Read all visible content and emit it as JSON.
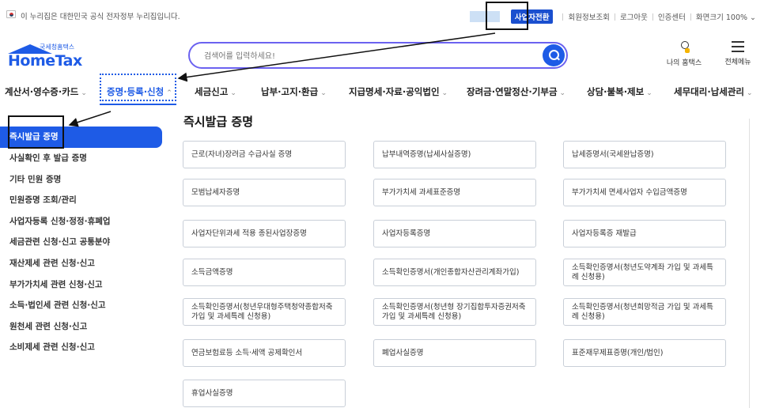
{
  "gov_banner": {
    "text": "이 누리집은 대한민국 공식 전자정부 누리집입니다."
  },
  "utility": {
    "business_switch": "사업자전환",
    "member_info": "회원정보조회",
    "logout": "로그아웃",
    "cert_center": "인증센터",
    "zoom": "화면크기 100%",
    "zoom_icon": "chevron-down-icon"
  },
  "logo": {
    "sub": "국세청홈택스",
    "main": "HomeTax"
  },
  "search": {
    "placeholder": "검색어를 입력하세요!",
    "icon": "search-icon"
  },
  "header": {
    "my_hometax": "나의 홈택스",
    "all_menu": "전체메뉴"
  },
  "gnb": [
    {
      "label": "계산서·영수증·카드",
      "chevron": "⌄"
    },
    {
      "label": "증명·등록·신청",
      "chevron": "⌃"
    },
    {
      "label": "세금신고",
      "chevron": "⌄"
    },
    {
      "label": "납부·고지·환급",
      "chevron": "⌄"
    },
    {
      "label": "지급명세·자료·공익법인",
      "chevron": "⌄"
    },
    {
      "label": "장려금·연말정산·기부금",
      "chevron": "⌄"
    },
    {
      "label": "상담·불복·제보",
      "chevron": "⌄"
    },
    {
      "label": "세무대리·납세관리",
      "chevron": "⌄"
    }
  ],
  "sidebar": {
    "items": [
      {
        "label": "즉시발급 증명"
      },
      {
        "label": "사실확인 후 발급 증명"
      },
      {
        "label": "기타 민원 증명"
      },
      {
        "label": "민원증명 조회/관리"
      },
      {
        "label": "사업자등록 신청·정정·휴폐업"
      },
      {
        "label": "세금관련 신청·신고 공통분야"
      },
      {
        "label": "재산제세 관련 신청·신고"
      },
      {
        "label": "부가가치세 관련 신청·신고"
      },
      {
        "label": "소득·법인세 관련 신청·신고"
      },
      {
        "label": "원천세 관련 신청·신고"
      },
      {
        "label": "소비제세 관련 신청·신고"
      }
    ]
  },
  "main": {
    "title": "즉시발급 증명",
    "cards": [
      "근로(자녀)장려금 수급사실 증명",
      "납부내역증명(납세사실증명)",
      "납세증명서(국세완납증명)",
      "모범납세자증명",
      "부가가치세 과세표준증명",
      "부가가치세 면세사업자 수입금액증명",
      "사업자단위과세 적용 종된사업장증명",
      "사업자등록증명",
      "사업자등록증 재발급",
      "소득금액증명",
      "소득확인증명서(개인종합자산관리계좌가입)",
      "소득확인증명서(청년도약계좌 가입 및 과세특례 신청용)",
      "소득확인증명서(청년우대형주택청약종합저축 가입 및 과세특례 신청용)",
      "소득확인증명서(청년형 장기집합투자증권저축 가입 및 과세특례 신청용)",
      "소득확인증명서(청년희망적금 가입 및 과세특례 신청용)",
      "연금보험료등 소득·세액 공제확인서",
      "폐업사실증명",
      "표준재무제표증명(개인/법인)",
      "휴업사실증명"
    ]
  }
}
